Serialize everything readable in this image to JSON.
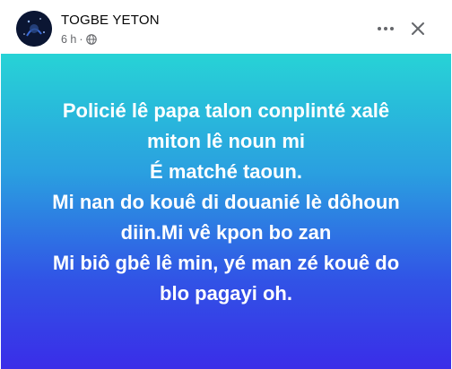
{
  "post": {
    "author": "TOGBE YETON",
    "time": "6 h",
    "separator": "·",
    "body_lines": [
      "Policié lê papa talon conplinté xalê",
      "miton lê noun mi",
      "É matché taoun.",
      "Mi nan do kouê di douanié lè dôhoun",
      "diin.Mi vê kpon bo zan",
      "Mi biô gbê lê min, yé man zé kouê do",
      "blo pagayi oh."
    ],
    "background_colors": [
      "#27d3d6",
      "#2a9fe0",
      "#3153e6",
      "#3a2de8"
    ]
  },
  "icons": {
    "audience": "globe-icon",
    "more": "more-options-icon",
    "close": "close-icon"
  }
}
